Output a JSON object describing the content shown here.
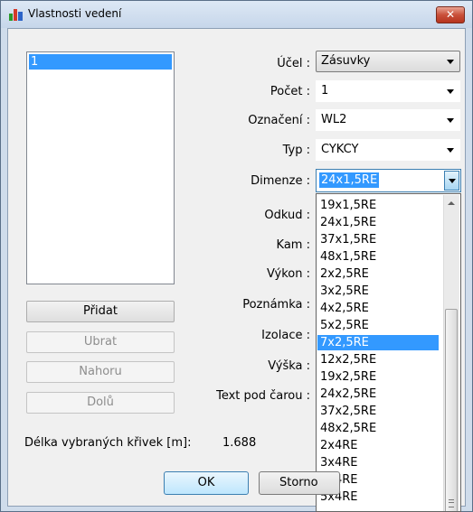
{
  "window": {
    "title": "Vlastnosti vedení",
    "close_label": "✕"
  },
  "list": {
    "items": [
      "1"
    ]
  },
  "buttons": {
    "pridat": "Přidat",
    "ubrat": "Ubrat",
    "nahoru": "Nahoru",
    "dolu": "Dolů"
  },
  "fields": {
    "ucel": {
      "label": "Účel :",
      "value": "Zásuvky"
    },
    "pocet": {
      "label": "Počet :",
      "value": "1"
    },
    "oznaceni": {
      "label": "Označení :",
      "value": "WL2"
    },
    "typ": {
      "label": "Typ :",
      "value": "CYKCY"
    },
    "dimenze": {
      "label": "Dimenze :",
      "value": "24x1,5RE"
    },
    "odkud": {
      "label": "Odkud :"
    },
    "kam": {
      "label": "Kam :"
    },
    "vykon": {
      "label": "Výkon :"
    },
    "poznamka": {
      "label": "Poznámka :"
    },
    "izolace": {
      "label": "Izolace :"
    },
    "vyska": {
      "label": "Výška :"
    },
    "text_pod_carou": {
      "label": "Text pod čarou :"
    }
  },
  "dropdown": {
    "options": [
      "19x1,5RE",
      "24x1,5RE",
      "37x1,5RE",
      "48x1,5RE",
      "2x2,5RE",
      "3x2,5RE",
      "4x2,5RE",
      "5x2,5RE",
      "7x2,5RE",
      "12x2,5RE",
      "19x2,5RE",
      "24x2,5RE",
      "37x2,5RE",
      "48x2,5RE",
      "2x4RE",
      "3x4RE",
      "4x4RE",
      "5x4RE"
    ],
    "selected_index": 8
  },
  "length": {
    "label": "Délka vybraných křivek [m]:",
    "value": "1.688"
  },
  "footer": {
    "ok": "OK",
    "storno": "Storno"
  },
  "colors": {
    "selection": "#3399ff",
    "frame": "#cfdceb",
    "close": "#c9503a"
  }
}
